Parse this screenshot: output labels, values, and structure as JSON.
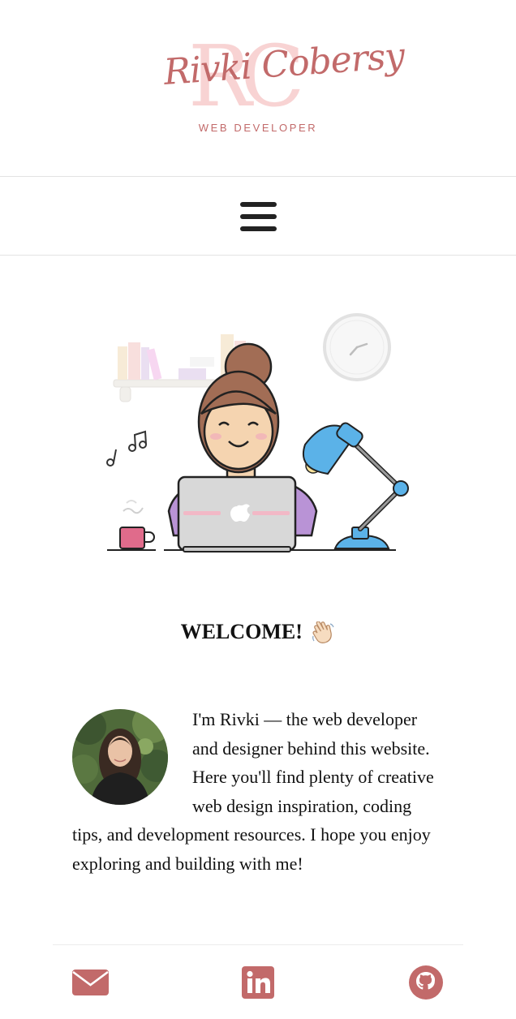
{
  "header": {
    "logo_monogram": "RC",
    "logo_name": "Rivki Cobersy",
    "logo_tagline": "WEB DEVELOPER"
  },
  "nav": {
    "menu_icon": "hamburger-menu-icon"
  },
  "hero": {
    "illustration": "woman-at-laptop-illustration"
  },
  "welcome": {
    "heading": "WELCOME!",
    "emoji_icon": "waving-hand-icon"
  },
  "about": {
    "text": "I'm Rivki — the web developer and designer behind this website. Here you'll find plenty of creative web design inspiration, coding tips, and development resources. I hope you enjoy exploring and building with me!"
  },
  "social": {
    "items": [
      {
        "icon": "envelope-icon"
      },
      {
        "icon": "linkedin-icon"
      },
      {
        "icon": "github-icon"
      }
    ]
  },
  "colors": {
    "brand_rose": "#c26a6a",
    "monogram_pink": "#f8d3d3",
    "divider": "#e3e3e3"
  }
}
